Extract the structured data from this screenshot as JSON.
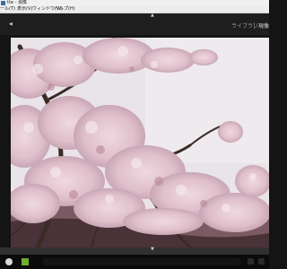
{
  "window": {
    "title": "tte - 現像"
  },
  "menu": {
    "items": [
      "ール(T)",
      "表示(V)",
      "ウィンドウ(W)",
      "ヘルプ(H)"
    ]
  },
  "modules": {
    "library": "ライブラリ",
    "develop": "現像"
  },
  "glyphs": {
    "collapse_up": "▲",
    "collapse_left": "◀",
    "collapse_down": "▼"
  },
  "colors": {
    "background": "#141414",
    "sky": "#e9e4e8",
    "blossom": "#e2c7d2",
    "branch": "#3a2b25"
  }
}
